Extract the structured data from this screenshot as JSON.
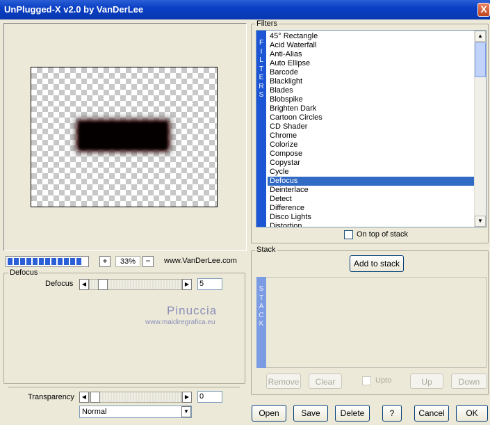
{
  "window": {
    "title": "UnPlugged-X v2.0 by VanDerLee",
    "close_label": "X"
  },
  "preview": {
    "zoom_value": "33%",
    "zoom_in_label": "+",
    "zoom_out_label": "−",
    "website": "www.VanDerLee.com",
    "progress_blocks": 12
  },
  "filters": {
    "group_label": "Filters",
    "vertical_label": [
      "F",
      "I",
      "L",
      "T",
      "E",
      "R",
      "S"
    ],
    "items": [
      "45° Rectangle",
      "Acid Waterfall",
      "Anti-Alias",
      "Auto Ellipse",
      "Barcode",
      "Blacklight",
      "Blades",
      "Blobspike",
      "Brighten Dark",
      "Cartoon Circles",
      "CD Shader",
      "Chrome",
      "Colorize",
      "Compose",
      "Copystar",
      "Cycle",
      "Defocus",
      "Deinterlace",
      "Detect",
      "Difference",
      "Disco Lights",
      "Distortion"
    ],
    "selected": "Defocus",
    "on_top_label": "On top of stack"
  },
  "defocus": {
    "group_label": "Defocus",
    "param_label": "Defocus",
    "param_value": "5",
    "param_fraction": 0.05
  },
  "watermark": {
    "name": "Pinuccia",
    "url": "www.maidiregrafica.eu"
  },
  "transparency": {
    "label": "Transparency",
    "value": "0",
    "mode": "Normal"
  },
  "stack": {
    "group_label": "Stack",
    "add_label": "Add to stack",
    "vertical_label": [
      "S",
      "T",
      "A",
      "C",
      "K"
    ],
    "remove_label": "Remove",
    "clear_label": "Clear",
    "upto_label": "Upto",
    "up_label": "Up",
    "down_label": "Down"
  },
  "buttons": {
    "open": "Open",
    "save": "Save",
    "delete": "Delete",
    "help": "?",
    "cancel": "Cancel",
    "ok": "OK"
  },
  "colors": {
    "titlebar": "#0a3fc4",
    "selection": "#316ac5",
    "filters_strip": "#1c56d4",
    "stack_strip": "#7b9ce3"
  }
}
